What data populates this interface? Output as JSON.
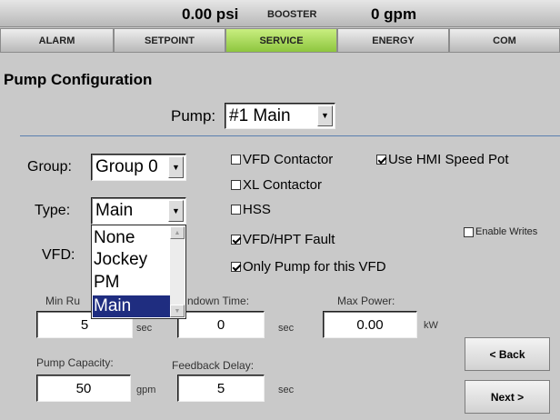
{
  "status": {
    "pressure": "0.00 psi",
    "mode": "BOOSTER",
    "flow": "0 gpm"
  },
  "tabs": [
    {
      "label": "ALARM"
    },
    {
      "label": "SETPOINT"
    },
    {
      "label": "SERVICE"
    },
    {
      "label": "ENERGY"
    },
    {
      "label": "COM"
    }
  ],
  "active_tab": "SERVICE",
  "page_title": "Pump Configuration",
  "pump": {
    "label": "Pump:",
    "value": "#1 Main"
  },
  "group": {
    "label": "Group:",
    "value": "Group 0"
  },
  "type": {
    "label": "Type:",
    "value": "Main",
    "options": [
      "None",
      "Jockey",
      "PM",
      "Main"
    ],
    "selected": "Main"
  },
  "vfd": {
    "label": "VFD:"
  },
  "checkboxes": {
    "vfd_contactor": {
      "label": "VFD Contactor",
      "checked": false
    },
    "use_hmi_speed_pot": {
      "label": "Use HMI Speed Pot",
      "checked": true
    },
    "xl_contactor": {
      "label": "XL Contactor",
      "checked": false
    },
    "hss": {
      "label": "HSS",
      "checked": false
    },
    "vfd_hpt_fault": {
      "label": "VFD/HPT Fault",
      "checked": true
    },
    "only_pump_for_vfd": {
      "label": "Only Pump for this VFD",
      "checked": true
    },
    "enable_writes": {
      "label": "Enable Writes",
      "checked": false
    }
  },
  "fields": {
    "min_run_label": "Min Ru",
    "min_run_value": "5",
    "min_run_unit": "sec",
    "rundown_label": "ndown Time:",
    "rundown_value": "0",
    "rundown_unit": "sec",
    "max_power_label": "Max Power:",
    "max_power_value": "0.00",
    "max_power_unit": "kW",
    "capacity_label": "Pump Capacity:",
    "capacity_value": "50",
    "capacity_unit": "gpm",
    "feedback_label": "Feedback Delay:",
    "feedback_value": "5",
    "feedback_unit": "sec"
  },
  "buttons": {
    "back": "< Back",
    "next": "Next >"
  },
  "colors": {
    "active_tab": "#9ccf52",
    "selection": "#1f2d80",
    "divider": "#5a7fb0"
  }
}
